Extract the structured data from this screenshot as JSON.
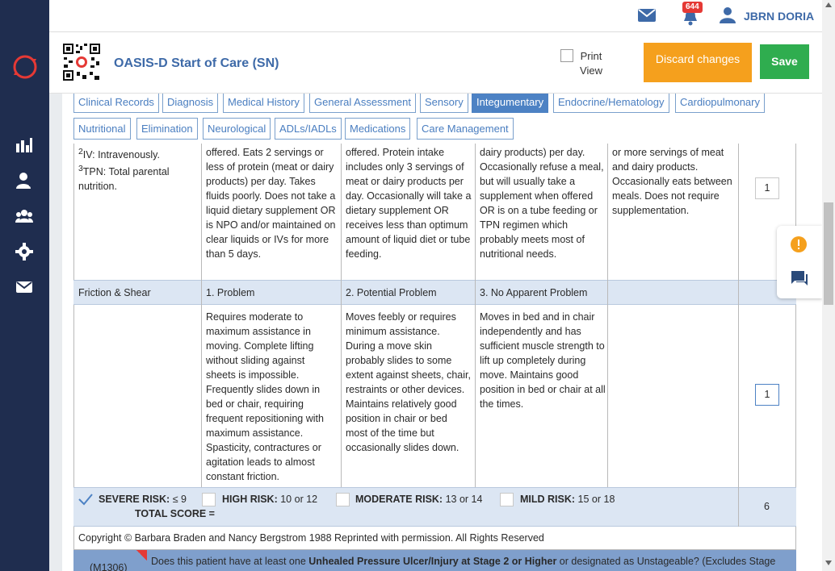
{
  "topbar": {
    "notification_count": "644",
    "user_name": "JBRN DORIA"
  },
  "header": {
    "title": "OASIS-D Start of Care (SN)",
    "print_label": "Print View",
    "discard_label": "Discard changes",
    "save_label": "Save"
  },
  "tabs": {
    "row1": [
      "Clinical Records",
      "Diagnosis",
      "Medical History",
      "General Assessment",
      "Sensory",
      "Integumentary",
      "Endocrine/Hematology",
      "Cardiopulmonary"
    ],
    "row2": [
      "Nutritional",
      "Elimination",
      "Neurological",
      "ADLs/IADLs",
      "Medications",
      "Care Management"
    ],
    "active": "Integumentary"
  },
  "nutrition": {
    "notes_iv": "IV: Intravenously.",
    "notes_tpn": "TPN: Total parental nutrition.",
    "col1": "offered. Eats 2 servings or less of protein (meat or dairy products) per day. Takes fluids poorly. Does not take a liquid dietary supplement OR is NPO and/or maintained on clear liquids or IVs for more than 5 days.",
    "col2": "offered. Protein intake includes only 3 servings of meat or dairy products per day. Occasionally will take a dietary supplement OR receives less than optimum amount of liquid diet or tube feeding.",
    "col3": "dairy products) per day. Occasionally refuse a meal, but will usually take a supplement when offered OR is on a tube feeding or TPN regimen which probably meets most of nutritional needs.",
    "col4": "or more servings of meat and dairy products. Occasionally eats between meals. Does not require supplementation.",
    "score": "1"
  },
  "friction": {
    "label": "Friction & Shear",
    "h1": "1. Problem",
    "h2": "2. Potential Problem",
    "h3": "3. No Apparent Problem",
    "col1": "Requires moderate to maximum assistance in moving. Complete lifting without sliding against sheets is impossible. Frequently slides down in bed or chair, requiring frequent repositioning with maximum assistance. Spasticity, contractures or agitation leads to almost constant friction.",
    "col2": "Moves feebly or requires minimum assistance. During a move skin probably slides to some extent against sheets, chair, restraints or other devices. Maintains relatively good position in chair or bed most of the time but occasionally slides down.",
    "col3": "Moves in bed and in chair independently and has sufficient muscle strength to lift up completely during move. Maintains good position in bed or chair at all the times.",
    "score": "1"
  },
  "risk": {
    "severe_label": "SEVERE RISK:",
    "severe_range": "≤ 9",
    "high_label": "HIGH RISK:",
    "high_range": "10 or 12",
    "moderate_label": "MODERATE RISK:",
    "moderate_range": "13 or 14",
    "mild_label": "MILD RISK:",
    "mild_range": "15 or 18",
    "total_label": "TOTAL SCORE =",
    "total_value": "6"
  },
  "copyright": "Copyright © Barbara Braden and Nancy Bergstrom 1988 Reprinted with permission. All Rights Reserved",
  "m1306": {
    "code": "(M1306)",
    "question_pre": "Does this patient have at least one ",
    "question_bold": "Unhealed Pressure Ulcer/Injury at Stage 2 or Higher",
    "question_post": " or designated as Unstageable? (Excludes Stage"
  },
  "colors": {
    "sidebar": "#1f2d4f",
    "accent": "#3e6aa8",
    "discard": "#f5a01d",
    "save": "#2fad4f",
    "band": "#dce6f3"
  }
}
